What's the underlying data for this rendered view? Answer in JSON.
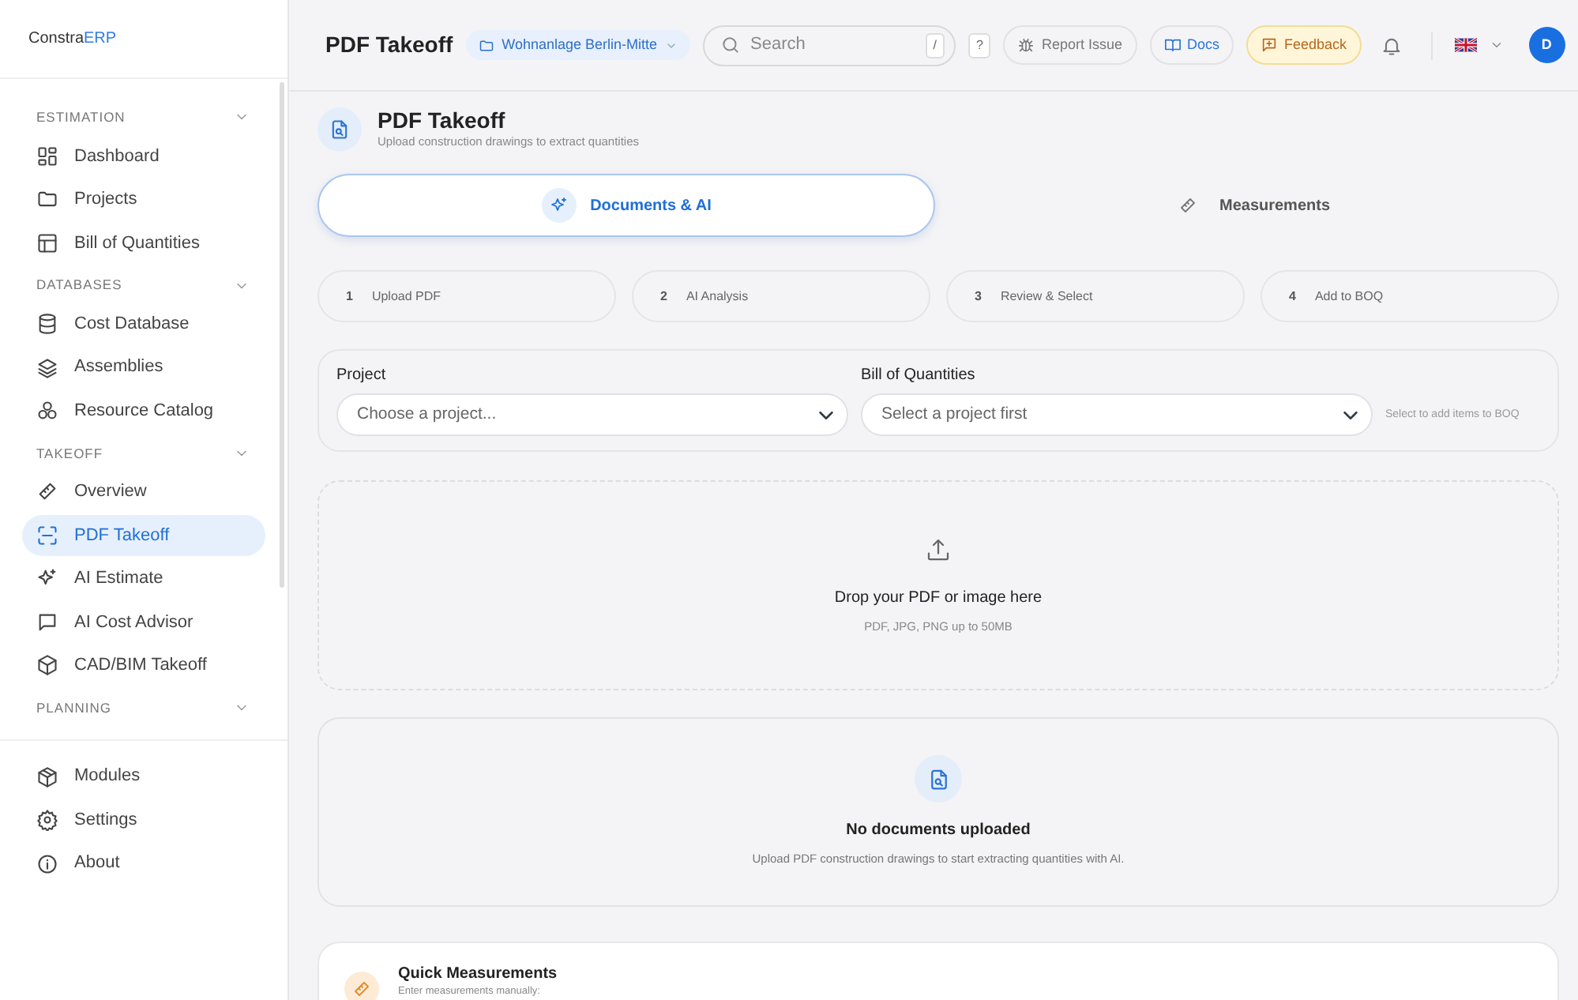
{
  "logo": {
    "main": "Constra",
    "accent": "ERP"
  },
  "sidebar": {
    "sections": [
      {
        "title": "ESTIMATION",
        "items": [
          {
            "label": "Dashboard",
            "selected": false
          },
          {
            "label": "Projects",
            "selected": false
          },
          {
            "label": "Bill of Quantities",
            "selected": false
          }
        ]
      },
      {
        "title": "DATABASES",
        "items": [
          {
            "label": "Cost Database",
            "selected": false
          },
          {
            "label": "Assemblies",
            "selected": false
          },
          {
            "label": "Resource Catalog",
            "selected": false
          }
        ]
      },
      {
        "title": "TAKEOFF",
        "items": [
          {
            "label": "Overview",
            "selected": false
          },
          {
            "label": "PDF Takeoff",
            "selected": true
          },
          {
            "label": "AI Estimate",
            "selected": false
          },
          {
            "label": "AI Cost Advisor",
            "selected": false
          },
          {
            "label": "CAD/BIM Takeoff",
            "selected": false
          }
        ]
      },
      {
        "title": "PLANNING"
      }
    ],
    "footer_items": [
      {
        "label": "Modules",
        "selected": false
      },
      {
        "label": "Settings",
        "selected": false
      },
      {
        "label": "About",
        "selected": false
      }
    ]
  },
  "topbar": {
    "title": "PDF Takeoff",
    "project": "Wohnanlage Berlin-Mitte",
    "search_placeholder": "Search",
    "search_shortcut": "/",
    "help": "?",
    "buttons": [
      {
        "kind": "report",
        "label": "Report Issue"
      },
      {
        "kind": "docs",
        "label": "Docs"
      },
      {
        "kind": "feedback",
        "label": "Feedback"
      }
    ],
    "avatar": "D"
  },
  "page": {
    "title": "PDF Takeoff",
    "subtitle": "Upload construction drawings to extract quantities",
    "tabs": [
      {
        "label": "Documents & AI",
        "selected": true
      },
      {
        "label": "Measurements",
        "selected": false
      }
    ],
    "steps": [
      {
        "number": "1",
        "label": "Upload PDF"
      },
      {
        "number": "2",
        "label": "AI Analysis"
      },
      {
        "number": "3",
        "label": "Review & Select"
      },
      {
        "number": "4",
        "label": "Add to BOQ"
      }
    ],
    "form": {
      "project_label": "Project",
      "project_value": "Choose a project...",
      "boq_label": "Bill of Quantities",
      "boq_value": "Select a project first",
      "hint": "Select to add items to BOQ"
    },
    "dropzone": {
      "title": "Drop your PDF or image here",
      "hint": "PDF, JPG, PNG up to 50MB"
    },
    "empty": {
      "title": "No documents uploaded",
      "text": "Upload PDF construction drawings to start extracting quantities with AI."
    },
    "quick": {
      "title": "Quick Measurements",
      "subtitle": "Enter measurements manually:"
    }
  }
}
